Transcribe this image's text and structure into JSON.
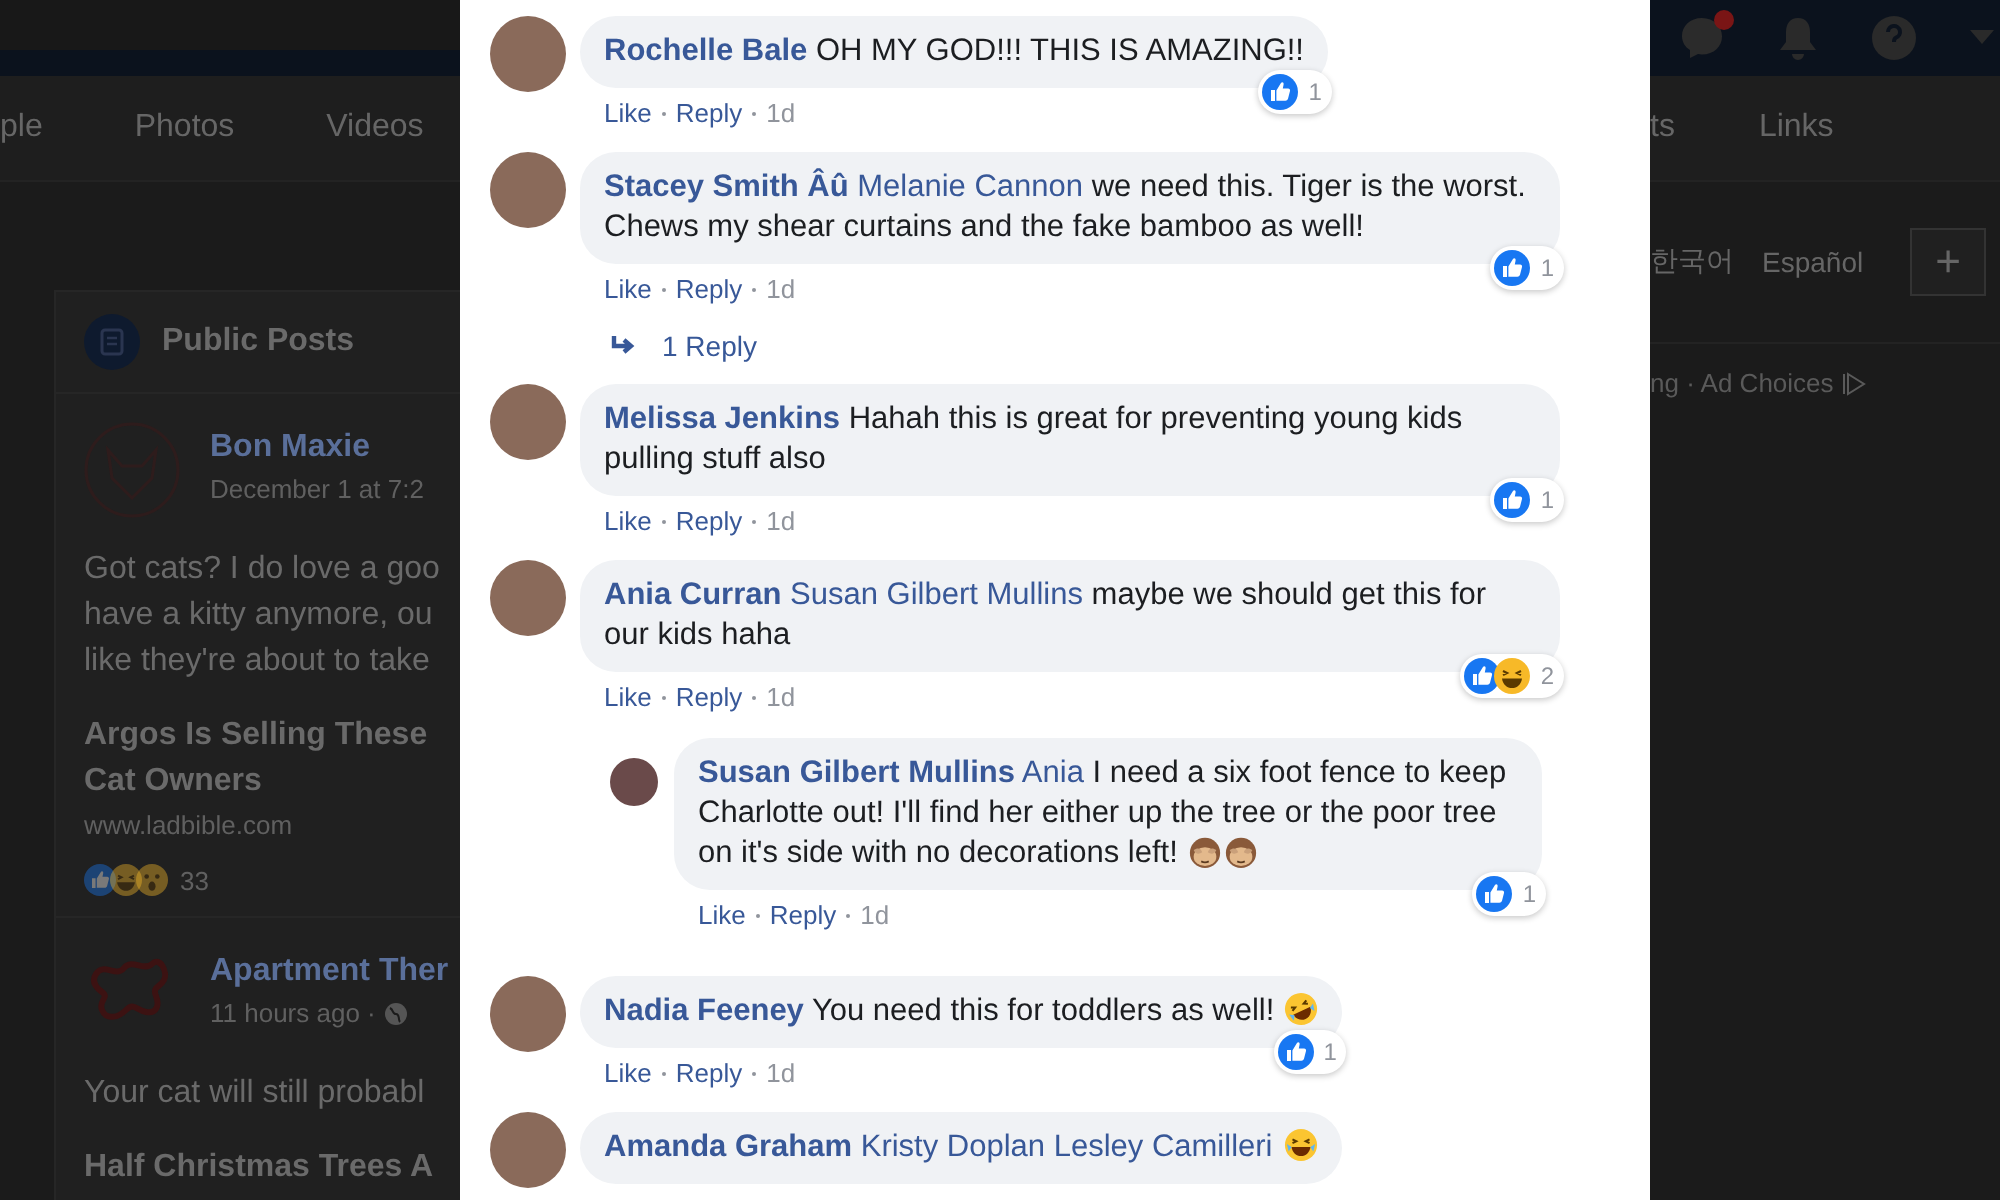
{
  "left_page": {
    "tabs": [
      "ple",
      "Photos",
      "Videos"
    ],
    "card": {
      "title": "Public Posts",
      "posts": [
        {
          "logo": {
            "kind": "fox"
          },
          "author": "Bon Maxie",
          "time": "December 1 at 7:2",
          "text_lines": [
            "Got cats? I do love a goo",
            "have a kitty anymore, ou",
            "like they're about to take"
          ],
          "link_title_lines": [
            "Argos Is Selling These",
            "Cat Owners"
          ],
          "link_domain": "www.ladbible.com",
          "reactions": [
            {
              "kind": "like"
            },
            {
              "kind": "haha"
            },
            {
              "kind": "wow"
            }
          ],
          "reaction_count": "33"
        },
        {
          "logo": {
            "kind": "squiggle"
          },
          "author": "Apartment Ther",
          "time": "11 hours ago ·",
          "public": true,
          "text_lines": [
            "Your cat will still probabl"
          ],
          "link_title_lines": [
            "Half Christmas Trees A"
          ]
        }
      ]
    }
  },
  "comments": [
    {
      "author": "Rochelle Bale",
      "text": "OH MY GOD!!! THIS IS AMAZING!!",
      "reactions": [
        {
          "kind": "like"
        }
      ],
      "reaction_count": "1",
      "like": "Like",
      "reply": "Reply",
      "time": "1d"
    },
    {
      "author": "Stacey Smith Âû",
      "mention": "Melanie Cannon",
      "text": "we need this. Tiger is the worst. Chews my shear curtains and the fake bamboo as well!",
      "reactions": [
        {
          "kind": "like"
        }
      ],
      "reaction_count": "1",
      "like": "Like",
      "reply": "Reply",
      "time": "1d",
      "replies_link": "1 Reply"
    },
    {
      "author": "Melissa Jenkins",
      "text": "Hahah this is great for preventing young kids pulling stuff also",
      "reactions": [
        {
          "kind": "like"
        }
      ],
      "reaction_count": "1",
      "like": "Like",
      "reply": "Reply",
      "time": "1d"
    },
    {
      "author": "Ania Curran",
      "mention": "Susan Gilbert Mullins",
      "text": "maybe we should get this for our kids haha",
      "reactions": [
        {
          "kind": "like"
        },
        {
          "kind": "haha"
        }
      ],
      "reaction_count": "2",
      "like": "Like",
      "reply": "Reply",
      "time": "1d",
      "children": [
        {
          "author": "Susan Gilbert Mullins",
          "mention": "Ania",
          "text": "I need a six foot fence to keep Charlotte out! I'll find her either up the tree or the poor tree on it's side with no decorations left!",
          "emojis": [
            {
              "kind": "monkey"
            },
            {
              "kind": "monkey"
            }
          ],
          "reactions": [
            {
              "kind": "like"
            }
          ],
          "reaction_count": "1",
          "like": "Like",
          "reply": "Reply",
          "time": "1d"
        }
      ]
    },
    {
      "author": "Nadia Feeney",
      "text": "You need this for toddlers as well!",
      "emojis": [
        {
          "kind": "rofl"
        }
      ],
      "reactions": [
        {
          "kind": "like"
        }
      ],
      "reaction_count": "1",
      "like": "Like",
      "reply": "Reply",
      "time": "1d"
    },
    {
      "author": "Amanda Graham",
      "mention": "Kristy Doplan Lesley Camilleri",
      "emojis": [
        {
          "kind": "joy"
        }
      ]
    }
  ],
  "right_page": {
    "unread": true,
    "tabs": [
      "ts",
      "Links"
    ],
    "languages": [
      "한국어",
      "Español"
    ],
    "add_button": "+",
    "footer": "ng · Ad Choices"
  }
}
